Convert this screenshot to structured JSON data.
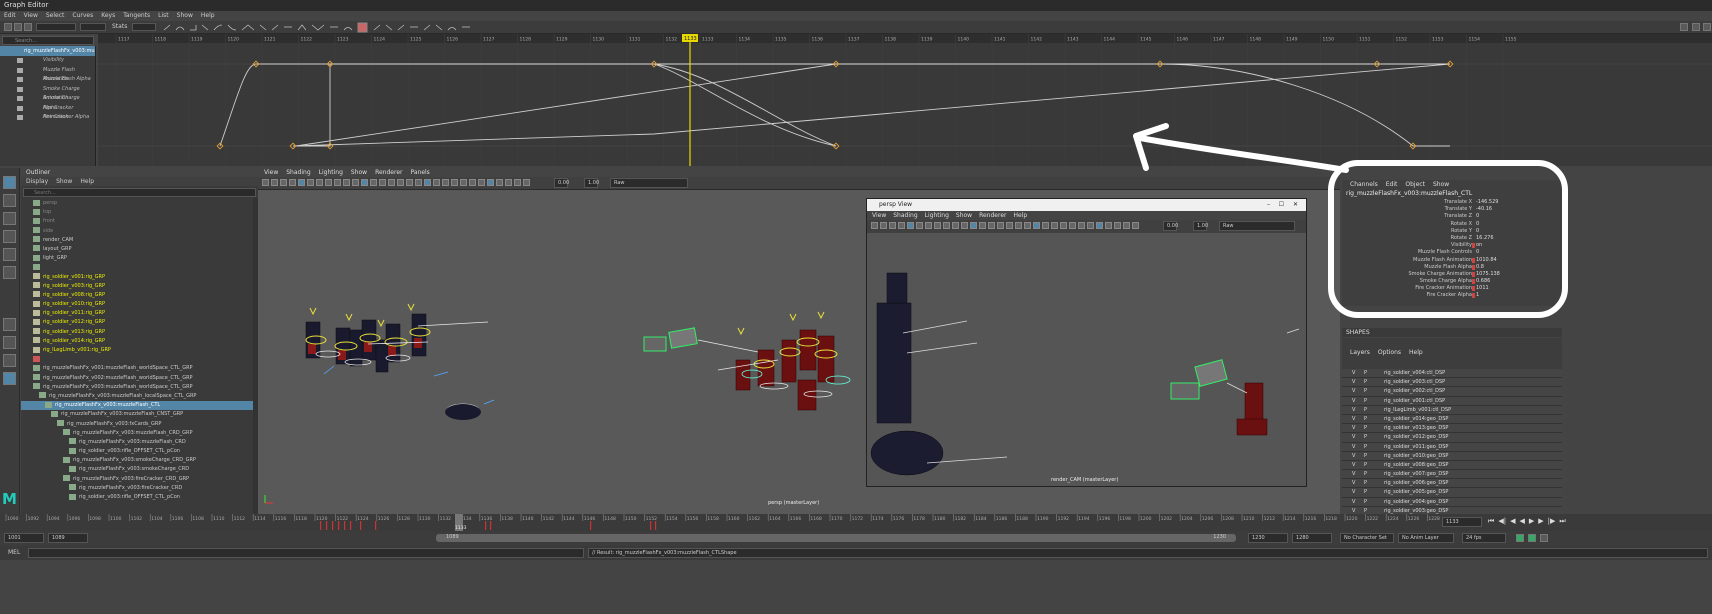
{
  "window_title": "Graph Editor",
  "graph_editor": {
    "menu": [
      "Edit",
      "View",
      "Select",
      "Curves",
      "Keys",
      "Tangents",
      "List",
      "Show",
      "Help"
    ],
    "stats_label": "Stats",
    "search_placeholder": "Search...",
    "node": "rig_muzzleFlashFx_v003:mu",
    "channels": [
      "Visibility",
      "Muzzle Flash Animation",
      "Muzzle Flash Alpha",
      "Smoke Charge Animation",
      "Smoke Charge Alpha",
      "Fire Cracker Animation",
      "Fire Cracker Alpha"
    ],
    "ruler_ticks": [
      "1117",
      "1118",
      "1119",
      "1120",
      "1121",
      "1122",
      "1123",
      "1124",
      "1125",
      "1126",
      "1127",
      "1128",
      "1129",
      "1130",
      "1131",
      "1132",
      "1133",
      "1134",
      "1135",
      "1136",
      "1137",
      "1138",
      "1139",
      "1140",
      "1141",
      "1142",
      "1143",
      "1144",
      "1145",
      "1146",
      "1147",
      "1148",
      "1149",
      "1150",
      "1151",
      "1152",
      "1153",
      "1154",
      "1155"
    ],
    "current_frame": "1133"
  },
  "outliner": {
    "title": "Outliner",
    "menu": [
      "Display",
      "Show",
      "Help"
    ],
    "search_placeholder": "Search...",
    "items": [
      {
        "label": "persp",
        "style": "dim",
        "indent": 1
      },
      {
        "label": "top",
        "style": "dim",
        "indent": 1
      },
      {
        "label": "front",
        "style": "dim",
        "indent": 1
      },
      {
        "label": "side",
        "style": "dim",
        "indent": 1
      },
      {
        "label": "render_CAM",
        "style": "",
        "indent": 1
      },
      {
        "label": "layout_GRP",
        "style": "",
        "indent": 1
      },
      {
        "label": "light_GRP",
        "style": "",
        "indent": 1
      },
      {
        "label": "",
        "style": "",
        "indent": 1
      },
      {
        "label": "rig_soldier_v001:rig_GRP",
        "style": "y",
        "indent": 1
      },
      {
        "label": "rig_soldier_v003:rig_GRP",
        "style": "y",
        "indent": 1
      },
      {
        "label": "rig_soldier_v008:rig_GRP",
        "style": "y",
        "indent": 1
      },
      {
        "label": "rig_soldier_v010:rig_GRP",
        "style": "y",
        "indent": 1
      },
      {
        "label": "rig_soldier_v011:rig_GRP",
        "style": "y",
        "indent": 1
      },
      {
        "label": "rig_soldier_v012:rig_GRP",
        "style": "y",
        "indent": 1
      },
      {
        "label": "rig_soldier_v013:rig_GRP",
        "style": "y",
        "indent": 1
      },
      {
        "label": "rig_soldier_v014:rig_GRP",
        "style": "y",
        "indent": 1
      },
      {
        "label": "rig_ILegLimb_v001:rig_GRP",
        "style": "y",
        "indent": 1
      },
      {
        "label": "",
        "style": "r",
        "indent": 1
      },
      {
        "label": "rig_muzzleFlashFx_v001:muzzleFlash_worldSpace_CTL_GRP",
        "style": "",
        "indent": 1
      },
      {
        "label": "rig_muzzleFlashFx_v002:muzzleFlash_worldSpace_CTL_GRP",
        "style": "",
        "indent": 1
      },
      {
        "label": "rig_muzzleFlashFx_v003:muzzleFlash_worldSpace_CTL_GRP",
        "style": "",
        "indent": 1
      },
      {
        "label": "rig_muzzleFlashFx_v003:muzzleFlash_localSpace_CTL_GRP",
        "style": "",
        "indent": 2
      },
      {
        "label": "rig_muzzleFlashFx_v003:muzzleFlash_CTL",
        "style": "sel",
        "indent": 3
      },
      {
        "label": "rig_muzzleFlashFx_v003:muzzleFlash_CNST_GRP",
        "style": "",
        "indent": 4
      },
      {
        "label": "rig_muzzleFlashFx_v003:fxCards_GRP",
        "style": "",
        "indent": 5
      },
      {
        "label": "rig_muzzleFlashFx_v003:muzzleFlash_CRD_GRP",
        "style": "",
        "indent": 6
      },
      {
        "label": "rig_muzzleFlashFx_v003:muzzleFlash_CRD",
        "style": "",
        "indent": 7
      },
      {
        "label": "rig_soldier_v003:rifle_OFFSET_CTL_pCon",
        "style": "",
        "indent": 7
      },
      {
        "label": "rig_muzzleFlashFx_v003:smokeCharge_CRD_GRP",
        "style": "",
        "indent": 6
      },
      {
        "label": "rig_muzzleFlashFx_v003:smokeCharge_CRD",
        "style": "",
        "indent": 7
      },
      {
        "label": "rig_muzzleFlashFx_v003:fireCracker_CRD_GRP",
        "style": "",
        "indent": 6
      },
      {
        "label": "rig_muzzleFlashFx_v003:fireCracker_CRD",
        "style": "",
        "indent": 7
      },
      {
        "label": "rig_soldier_v003:rifle_OFFSET_CTL_pCon",
        "style": "",
        "indent": 7
      }
    ]
  },
  "viewport": {
    "menu": [
      "View",
      "Shading",
      "Lighting",
      "Show",
      "Renderer",
      "Panels"
    ],
    "exposure": "0.00",
    "gamma": "1.00",
    "color_space": "Raw",
    "camera_label": "persp (masterLayer)"
  },
  "persp_window": {
    "title": "persp View",
    "menu": [
      "View",
      "Shading",
      "Lighting",
      "Show",
      "Renderer",
      "Help"
    ],
    "exposure": "0.00",
    "gamma": "1.00",
    "color_space": "Raw",
    "camera_label": "render_CAM (masterLayer)"
  },
  "channel_box": {
    "menu": [
      "Channels",
      "Edit",
      "Object",
      "Show"
    ],
    "node": "rig_muzzleFlashFx_v003:muzzleFlash_CTL",
    "attrs": [
      {
        "label": "Translate X",
        "value": "-146.529",
        "key": false
      },
      {
        "label": "Translate Y",
        "value": "-40.16",
        "key": false
      },
      {
        "label": "Translate Z",
        "value": "0",
        "key": false
      },
      {
        "label": "Rotate X",
        "value": "0",
        "key": false
      },
      {
        "label": "Rotate Y",
        "value": "0",
        "key": false
      },
      {
        "label": "Rotate Z",
        "value": "16.276",
        "key": false
      },
      {
        "label": "Visibility",
        "value": "on",
        "key": true
      },
      {
        "label": "Muzzle Flash Controls",
        "value": "0",
        "key": false
      },
      {
        "label": "Muzzle Flash Animation",
        "value": "1010.84",
        "key": true
      },
      {
        "label": "Muzzle Flash Alpha",
        "value": "0.8",
        "key": true
      },
      {
        "label": "Smoke Charge Animation",
        "value": "1075.138",
        "key": true
      },
      {
        "label": "Smoke Charge Alpha",
        "value": "0.686",
        "key": true
      },
      {
        "label": "Fire Cracker Animation",
        "value": "1011",
        "key": true
      },
      {
        "label": "Fire Cracker Alpha",
        "value": "1",
        "key": true
      }
    ],
    "shapes_label": "SHAPES"
  },
  "layers": {
    "menu": [
      "Layers",
      "Options",
      "Help"
    ],
    "rows": [
      {
        "v": "V",
        "p": "P",
        "name": "rig_soldier_v004:ctl_DSP"
      },
      {
        "v": "V",
        "p": "P",
        "name": "rig_soldier_v003:ctl_DSP"
      },
      {
        "v": "V",
        "p": "P",
        "name": "rig_soldier_v002:ctl_DSP"
      },
      {
        "v": "V",
        "p": "P",
        "name": "rig_soldier_v001:ctl_DSP"
      },
      {
        "v": "V",
        "p": "P",
        "name": "rig_ILegLimb_v001:ctl_DSP"
      },
      {
        "v": "V",
        "p": "P",
        "name": "rig_soldier_v014:geo_DSP"
      },
      {
        "v": "V",
        "p": "P",
        "name": "rig_soldier_v013:geo_DSP"
      },
      {
        "v": "V",
        "p": "P",
        "name": "rig_soldier_v012:geo_DSP"
      },
      {
        "v": "V",
        "p": "P",
        "name": "rig_soldier_v011:geo_DSP"
      },
      {
        "v": "V",
        "p": "P",
        "name": "rig_soldier_v010:geo_DSP"
      },
      {
        "v": "V",
        "p": "P",
        "name": "rig_soldier_v008:geo_DSP"
      },
      {
        "v": "V",
        "p": "P",
        "name": "rig_soldier_v007:geo_DSP"
      },
      {
        "v": "V",
        "p": "P",
        "name": "rig_soldier_v006:geo_DSP"
      },
      {
        "v": "V",
        "p": "P",
        "name": "rig_soldier_v005:geo_DSP"
      },
      {
        "v": "V",
        "p": "P",
        "name": "rig_soldier_v004:geo_DSP"
      },
      {
        "v": "V",
        "p": "P",
        "name": "rig_soldier_v003:geo_DSP"
      }
    ]
  },
  "timeline": {
    "ticks": [
      "1090",
      "1092",
      "1094",
      "1096",
      "1098",
      "1100",
      "1102",
      "1104",
      "1106",
      "1108",
      "1110",
      "1112",
      "1114",
      "1116",
      "1118",
      "1120",
      "1122",
      "1124",
      "1126",
      "1128",
      "1130",
      "1132",
      "1134",
      "1136",
      "1138",
      "1140",
      "1142",
      "1144",
      "1146",
      "1148",
      "1150",
      "1152",
      "1154",
      "1156",
      "1158",
      "1160",
      "1162",
      "1164",
      "1166",
      "1168",
      "1170",
      "1172",
      "1174",
      "1176",
      "1178",
      "1180",
      "1182",
      "1184",
      "1186",
      "1188",
      "1190",
      "1192",
      "1194",
      "1196",
      "1198",
      "1200",
      "1202",
      "1204",
      "1206",
      "1208",
      "1210",
      "1212",
      "1214",
      "1216",
      "1218",
      "1220",
      "1222",
      "1224",
      "1226",
      "1228"
    ],
    "current_frame": "1133",
    "current_frame_field": "1133"
  },
  "range": {
    "start": "1001",
    "playback_start": "1089",
    "slider_start": "1089",
    "slider_end": "1230",
    "playback_end": "1230",
    "end": "1280",
    "character_set": "No Character Set",
    "anim_layer": "No Anim Layer",
    "fps": "24 fps"
  },
  "command_line": {
    "language": "MEL",
    "result": "// Result: rig_muzzleFlashFx_v003:muzzleFlash_CTLShape"
  },
  "colors": {
    "selection": "#5285a6",
    "keyframe": "#e8a030",
    "current_time": "#e8d800",
    "annotation": "#ffffff"
  }
}
